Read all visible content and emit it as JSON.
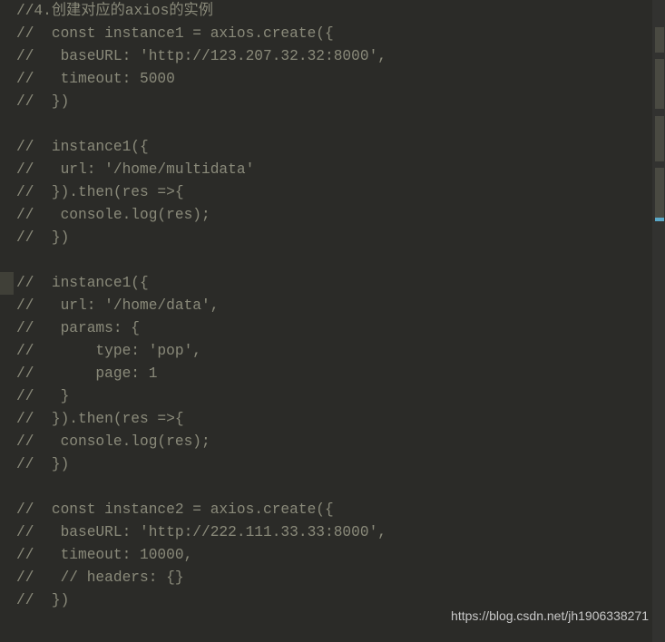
{
  "code": {
    "lines": [
      "//4.创建对应的axios的实例",
      "//  const instance1 = axios.create({",
      "//   baseURL: 'http://123.207.32.32:8000',",
      "//   timeout: 5000",
      "//  })",
      "",
      "//  instance1({",
      "//   url: '/home/multidata'",
      "//  }).then(res =>{",
      "//   console.log(res);",
      "//  })",
      "",
      "//  instance1({",
      "//   url: '/home/data',",
      "//   params: {",
      "//       type: 'pop',",
      "//       page: 1",
      "//   }",
      "//  }).then(res =>{",
      "//   console.log(res);",
      "//  })",
      "",
      "//  const instance2 = axios.create({",
      "//   baseURL: 'http://222.111.33.33:8000',",
      "//   timeout: 10000,",
      "//   // headers: {}",
      "//  })"
    ]
  },
  "watermark": "https://blog.csdn.net/jh1906338271"
}
